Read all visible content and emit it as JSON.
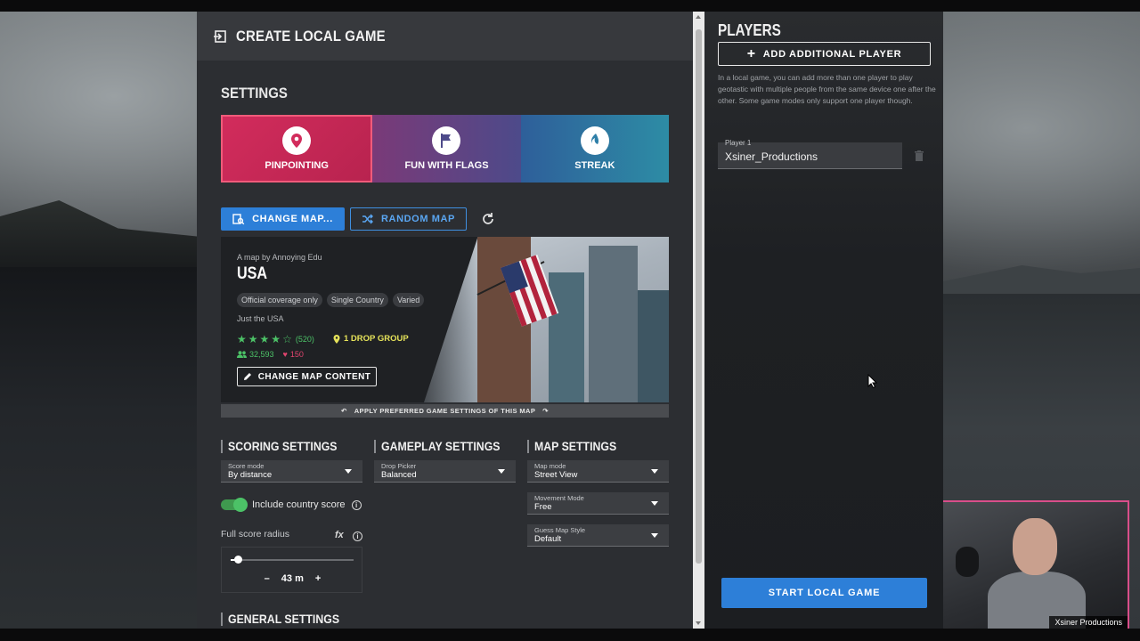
{
  "header": {
    "title": "CREATE LOCAL GAME"
  },
  "settings": {
    "title": "SETTINGS",
    "modes": [
      {
        "label": "PINPOINTING",
        "icon": "location-pin-icon",
        "selected": true
      },
      {
        "label": "FUN WITH FLAGS",
        "icon": "flag-icon",
        "selected": false
      },
      {
        "label": "STREAK",
        "icon": "streak-icon",
        "selected": false
      }
    ],
    "change_map_label": "CHANGE MAP...",
    "random_map_label": "RANDOM MAP"
  },
  "map": {
    "by_line": "A map by Annoying Edu",
    "name": "USA",
    "tags": [
      "Official coverage only",
      "Single Country",
      "Varied"
    ],
    "description": "Just the USA",
    "rating": 4.5,
    "rating_count": "(520)",
    "drop_group": "1 DROP GROUP",
    "players": "32,593",
    "likes": "150",
    "change_content_label": "CHANGE MAP CONTENT",
    "apply_label": "APPLY PREFERRED GAME SETTINGS OF THIS MAP"
  },
  "scoring": {
    "title": "SCORING SETTINGS",
    "score_mode_label": "Score mode",
    "score_mode_value": "By distance",
    "include_country_label": "Include country score",
    "include_country_on": true,
    "full_radius_label": "Full score radius",
    "fx_label": "fx",
    "radius_value": "43 m",
    "radius_fraction": 0.06,
    "minus": "–",
    "plus": "+"
  },
  "gameplay": {
    "title": "GAMEPLAY SETTINGS",
    "drop_picker_label": "Drop Picker",
    "drop_picker_value": "Balanced"
  },
  "map_settings": {
    "title": "MAP SETTINGS",
    "map_mode_label": "Map mode",
    "map_mode_value": "Street View",
    "movement_label": "Movement Mode",
    "movement_value": "Free",
    "guess_style_label": "Guess Map Style",
    "guess_style_value": "Default"
  },
  "general": {
    "title": "GENERAL SETTINGS"
  },
  "players": {
    "title": "PLAYERS",
    "add_label": "ADD ADDITIONAL PLAYER",
    "help": "In a local game, you can add more than one player to play geotastic with multiple people from the same device one after the other. Some game modes only support one player though.",
    "player1_label": "Player 1",
    "player1_value": "Xsiner_Productions",
    "start_label": "START LOCAL GAME"
  },
  "webcam": {
    "name": "Xsiner Productions"
  },
  "colors": {
    "accent": "#2d7fd8",
    "pinpointing": "#d22c5c",
    "success": "#4cc267",
    "warning": "#e6e35a"
  }
}
